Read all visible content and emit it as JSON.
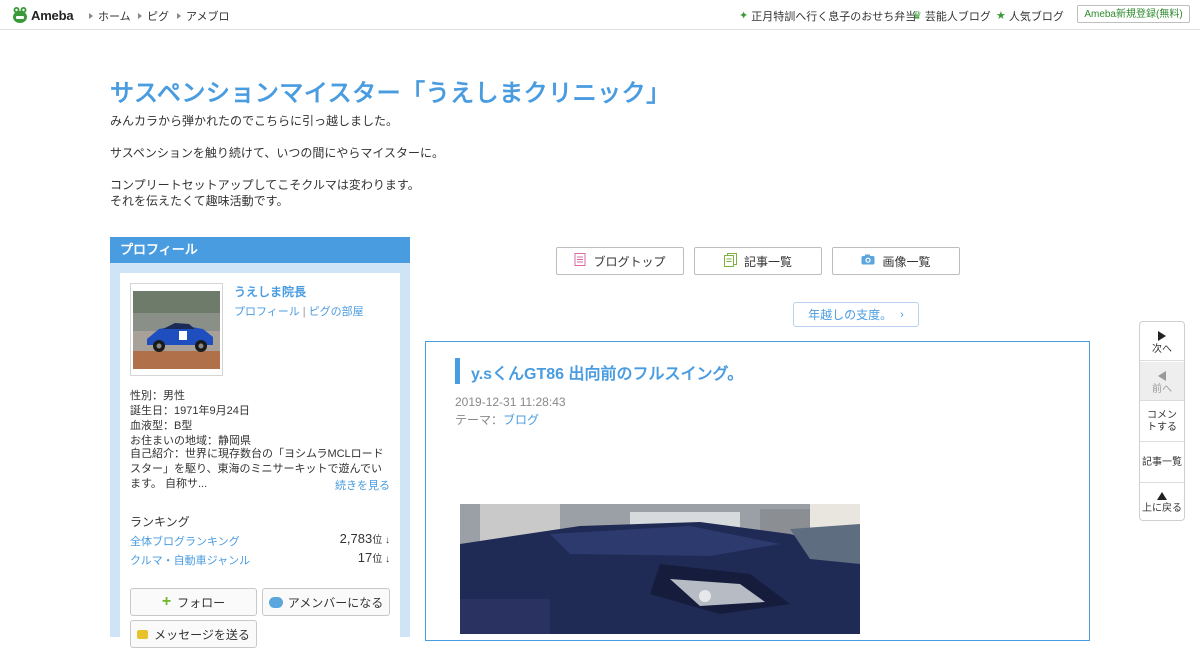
{
  "topbar": {
    "logo_text": "Ameba",
    "nav": [
      "ホーム",
      "ピグ",
      "アメブロ"
    ],
    "right_links": [
      {
        "icon": "sparkle-icon",
        "label": "正月特訓へ行く息子のおせち弁当"
      },
      {
        "icon": "crown-icon",
        "label": "芸能人ブログ"
      },
      {
        "icon": "star-icon",
        "label": "人気ブログ"
      }
    ],
    "register_label": "Ameba新規登録(無料)"
  },
  "header": {
    "title": "サスペンションマイスター「うえしまクリニック」",
    "desc": [
      "みんカラから弾かれたのでこちらに引っ越しました。",
      "サスペンションを触り続けて、いつの間にやらマイスターに。",
      "コンプリートセットアップしてこそクルマは変わります。",
      "それを伝えたくて趣味活動です。"
    ]
  },
  "profile": {
    "heading": "プロフィール",
    "name": "うえしま院長",
    "link_profile": "プロフィール",
    "link_pig": "ピグの部屋",
    "gender": "性別：男性",
    "birthday": "誕生日：1971年9月24日",
    "blood": "血液型：B型",
    "region": "お住まいの地域：静岡県",
    "intro": "自己紹介：世界に現存数台の「ヨシムラMCLロードスター」を駆り、東海のミニサーキットで遊んでいます。 自称サ...",
    "more": "続きを見る",
    "ranking_title": "ランキング",
    "rankings": [
      {
        "label": "全体ブログランキング",
        "value": "2,783",
        "unit": "位 ↓"
      },
      {
        "label": "クルマ・自動車ジャンル",
        "value": "17",
        "unit": "位 ↓"
      }
    ],
    "follow_label": "フォロー",
    "amember_label": "アメンバーになる",
    "message_label": "メッセージを送る"
  },
  "tabs": [
    {
      "icon": "document-icon",
      "label": "ブログトップ"
    },
    {
      "icon": "list-icon",
      "label": "記事一覧"
    },
    {
      "icon": "camera-icon",
      "label": "画像一覧"
    }
  ],
  "prev_entry": "年越しの支度。",
  "article": {
    "title": "y.sくんGT86 出向前のフルスイング。",
    "date": "2019-12-31 11:28:43",
    "theme_prefix": "テーマ：",
    "theme": "ブログ"
  },
  "sidenav": {
    "next": "次へ",
    "prev": "前へ",
    "comment": "コメントする",
    "list": "記事一覧",
    "top": "上に戻る"
  },
  "colors": {
    "accent": "#4a9ce0",
    "profile_bg": "#cfe4f7",
    "green": "#3a9a3a"
  }
}
